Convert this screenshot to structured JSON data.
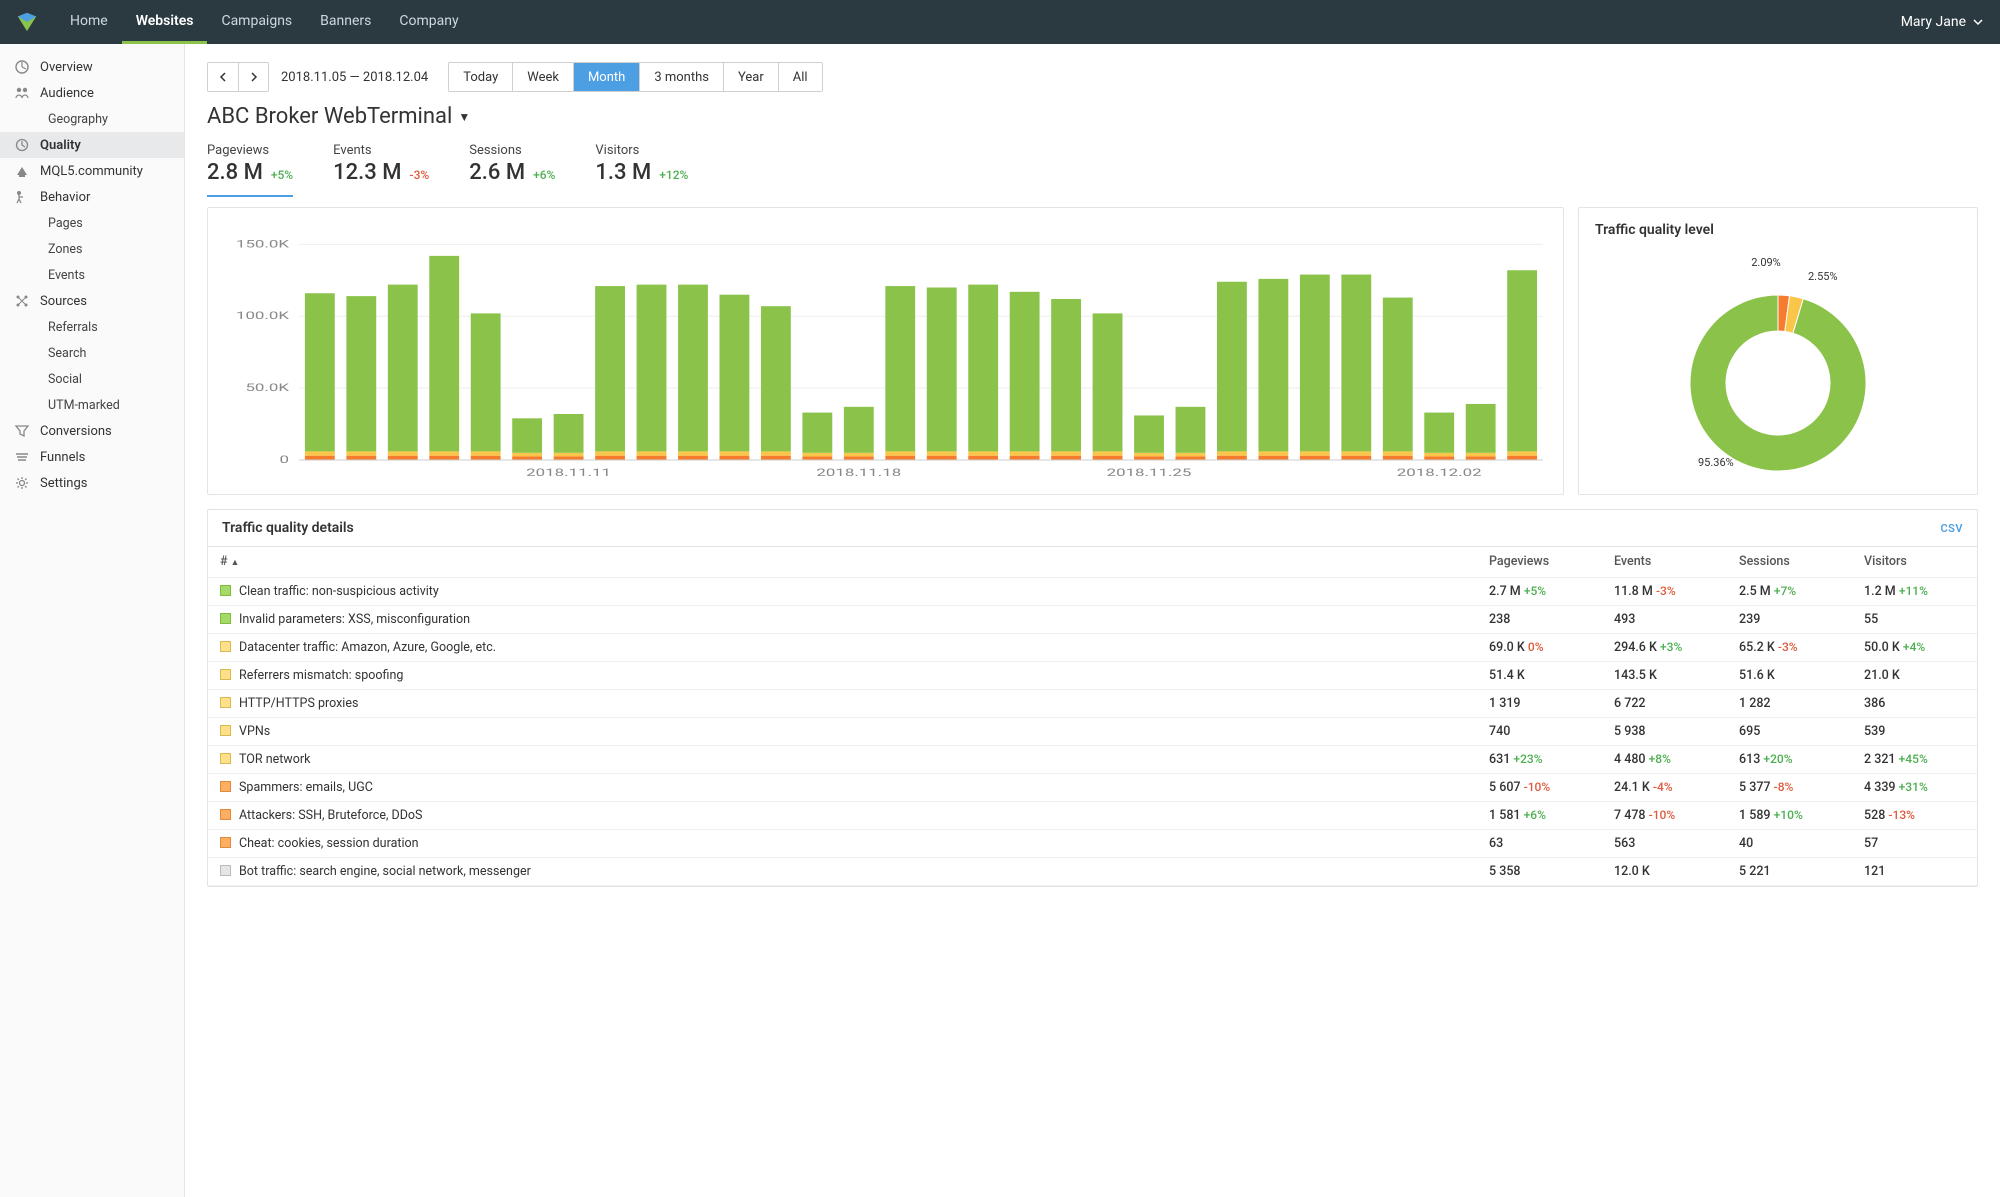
{
  "topnav": {
    "items": [
      "Home",
      "Websites",
      "Campaigns",
      "Banners",
      "Company"
    ],
    "active": 1,
    "user": "Mary Jane"
  },
  "sidebar": [
    {
      "icon": "overview",
      "label": "Overview"
    },
    {
      "icon": "audience",
      "label": "Audience"
    },
    {
      "sub": true,
      "label": "Geography"
    },
    {
      "icon": "quality",
      "label": "Quality",
      "active": true
    },
    {
      "icon": "mql5",
      "label": "MQL5.community"
    },
    {
      "icon": "behavior",
      "label": "Behavior"
    },
    {
      "sub": true,
      "label": "Pages"
    },
    {
      "sub": true,
      "label": "Zones"
    },
    {
      "sub": true,
      "label": "Events"
    },
    {
      "icon": "sources",
      "label": "Sources"
    },
    {
      "sub": true,
      "label": "Referrals"
    },
    {
      "sub": true,
      "label": "Search"
    },
    {
      "sub": true,
      "label": "Social"
    },
    {
      "sub": true,
      "label": "UTM-marked"
    },
    {
      "icon": "conversions",
      "label": "Conversions"
    },
    {
      "icon": "funnels",
      "label": "Funnels"
    },
    {
      "icon": "settings",
      "label": "Settings"
    }
  ],
  "daterange": "2018.11.05 — 2018.12.04",
  "ranges": [
    "Today",
    "Week",
    "Month",
    "3 months",
    "Year",
    "All"
  ],
  "range_active": 2,
  "page_title": "ABC Broker WebTerminal",
  "metrics": [
    {
      "label": "Pageviews",
      "value": "2.8 M",
      "delta": "+5%",
      "sign": "pos",
      "active": true
    },
    {
      "label": "Events",
      "value": "12.3 M",
      "delta": "-3%",
      "sign": "neg"
    },
    {
      "label": "Sessions",
      "value": "2.6 M",
      "delta": "+6%",
      "sign": "pos"
    },
    {
      "label": "Visitors",
      "value": "1.3 M",
      "delta": "+12%",
      "sign": "pos"
    }
  ],
  "donut": {
    "title": "Traffic quality level",
    "slices": [
      {
        "label": "95.36%",
        "value": 95.36,
        "color": "#8bc34a"
      },
      {
        "label": "2.09%",
        "value": 2.09,
        "color": "#f57c2e"
      },
      {
        "label": "2.55%",
        "value": 2.55,
        "color": "#f9c649"
      }
    ]
  },
  "details": {
    "title": "Traffic quality details",
    "csv": "CSV",
    "columns": [
      "#",
      "Pageviews",
      "Events",
      "Sessions",
      "Visitors"
    ],
    "rows": [
      {
        "sw": "g",
        "name": "Clean traffic: non-suspicious activity",
        "cells": [
          [
            "2.7 M",
            "+5%",
            "pos"
          ],
          [
            "11.8 M",
            "-3%",
            "neg"
          ],
          [
            "2.5 M",
            "+7%",
            "pos"
          ],
          [
            "1.2 M",
            "+11%",
            "pos"
          ]
        ]
      },
      {
        "sw": "g",
        "name": "Invalid parameters: XSS, misconfiguration",
        "cells": [
          [
            "238",
            "",
            ""
          ],
          [
            "493",
            "",
            ""
          ],
          [
            "239",
            "",
            ""
          ],
          [
            "55",
            "",
            ""
          ]
        ]
      },
      {
        "sw": "y",
        "name": "Datacenter traffic: Amazon, Azure, Google, etc.",
        "cells": [
          [
            "69.0 K",
            "0%",
            "neg"
          ],
          [
            "294.6 K",
            "+3%",
            "pos"
          ],
          [
            "65.2 K",
            "-3%",
            "neg"
          ],
          [
            "50.0 K",
            "+4%",
            "pos"
          ]
        ]
      },
      {
        "sw": "y",
        "name": "Referrers mismatch: spoofing",
        "cells": [
          [
            "51.4 K",
            "",
            ""
          ],
          [
            "143.5 K",
            "",
            ""
          ],
          [
            "51.6 K",
            "",
            ""
          ],
          [
            "21.0 K",
            "",
            ""
          ]
        ]
      },
      {
        "sw": "y",
        "name": "HTTP/HTTPS proxies",
        "cells": [
          [
            "1 319",
            "",
            ""
          ],
          [
            "6 722",
            "",
            ""
          ],
          [
            "1 282",
            "",
            ""
          ],
          [
            "386",
            "",
            ""
          ]
        ]
      },
      {
        "sw": "y",
        "name": "VPNs",
        "cells": [
          [
            "740",
            "",
            ""
          ],
          [
            "5 938",
            "",
            ""
          ],
          [
            "695",
            "",
            ""
          ],
          [
            "539",
            "",
            ""
          ]
        ]
      },
      {
        "sw": "y",
        "name": "TOR network",
        "cells": [
          [
            "631",
            "+23%",
            "pos"
          ],
          [
            "4 480",
            "+8%",
            "pos"
          ],
          [
            "613",
            "+20%",
            "pos"
          ],
          [
            "2 321",
            "+45%",
            "pos"
          ]
        ]
      },
      {
        "sw": "o",
        "name": "Spammers: emails, UGC",
        "cells": [
          [
            "5 607",
            "-10%",
            "neg"
          ],
          [
            "24.1 K",
            "-4%",
            "neg"
          ],
          [
            "5 377",
            "-8%",
            "neg"
          ],
          [
            "4 339",
            "+31%",
            "pos"
          ]
        ]
      },
      {
        "sw": "o",
        "name": "Attackers: SSH, Bruteforce, DDoS",
        "cells": [
          [
            "1 581",
            "+6%",
            "pos"
          ],
          [
            "7 478",
            "-10%",
            "neg"
          ],
          [
            "1 589",
            "+10%",
            "pos"
          ],
          [
            "528",
            "-13%",
            "neg"
          ]
        ]
      },
      {
        "sw": "o",
        "name": "Cheat: cookies, session duration",
        "cells": [
          [
            "63",
            "",
            ""
          ],
          [
            "563",
            "",
            ""
          ],
          [
            "40",
            "",
            ""
          ],
          [
            "57",
            "",
            ""
          ]
        ]
      },
      {
        "sw": "gr",
        "name": "Bot traffic: search engine, social network, messenger",
        "cells": [
          [
            "5 358",
            "",
            ""
          ],
          [
            "12.0 K",
            "",
            ""
          ],
          [
            "5 221",
            "",
            ""
          ],
          [
            "121",
            "",
            ""
          ]
        ]
      }
    ]
  },
  "chart_data": {
    "type": "bar",
    "title": "",
    "ylabel": "",
    "ylim": [
      0,
      160000
    ],
    "yticks_labels": [
      "0",
      "50.0K",
      "100.0K",
      "150.0K"
    ],
    "yticks": [
      0,
      50000,
      100000,
      150000
    ],
    "xticks": [
      6,
      13,
      20,
      27
    ],
    "xtick_labels": [
      "2018.11.11",
      "2018.11.18",
      "2018.11.25",
      "2018.12.02"
    ],
    "categories": [
      "2018.11.05",
      "2018.11.06",
      "2018.11.07",
      "2018.11.08",
      "2018.11.09",
      "2018.11.10",
      "2018.11.11",
      "2018.11.12",
      "2018.11.13",
      "2018.11.14",
      "2018.11.15",
      "2018.11.16",
      "2018.11.17",
      "2018.11.18",
      "2018.11.19",
      "2018.11.20",
      "2018.11.21",
      "2018.11.22",
      "2018.11.23",
      "2018.11.24",
      "2018.11.25",
      "2018.11.26",
      "2018.11.27",
      "2018.11.28",
      "2018.11.29",
      "2018.11.30",
      "2018.12.01",
      "2018.12.02",
      "2018.12.03",
      "2018.12.04"
    ],
    "series": [
      {
        "name": "clean",
        "color": "#8bc34a",
        "values": [
          110000,
          108000,
          116000,
          136000,
          96000,
          24000,
          27000,
          115000,
          116000,
          116000,
          109000,
          101000,
          28000,
          32000,
          115000,
          114000,
          116000,
          111000,
          106000,
          96000,
          26000,
          32000,
          118000,
          120000,
          123000,
          123000,
          107000,
          28000,
          34000,
          126000
        ]
      },
      {
        "name": "warn",
        "color": "#f9c649",
        "values": [
          3000,
          3000,
          3000,
          3000,
          3000,
          2500,
          2500,
          3000,
          3000,
          3000,
          3000,
          3000,
          2500,
          2500,
          3000,
          3000,
          3000,
          3000,
          3000,
          3000,
          2500,
          2500,
          3000,
          3000,
          3000,
          3000,
          3000,
          2500,
          2500,
          3000
        ]
      },
      {
        "name": "bad",
        "color": "#f57c2e",
        "values": [
          3000,
          3000,
          3000,
          3000,
          3000,
          2500,
          2500,
          3000,
          3000,
          3000,
          3000,
          3000,
          2500,
          2500,
          3000,
          3000,
          3000,
          3000,
          3000,
          3000,
          2500,
          2500,
          3000,
          3000,
          3000,
          3000,
          3000,
          2500,
          2500,
          3000
        ]
      }
    ]
  }
}
